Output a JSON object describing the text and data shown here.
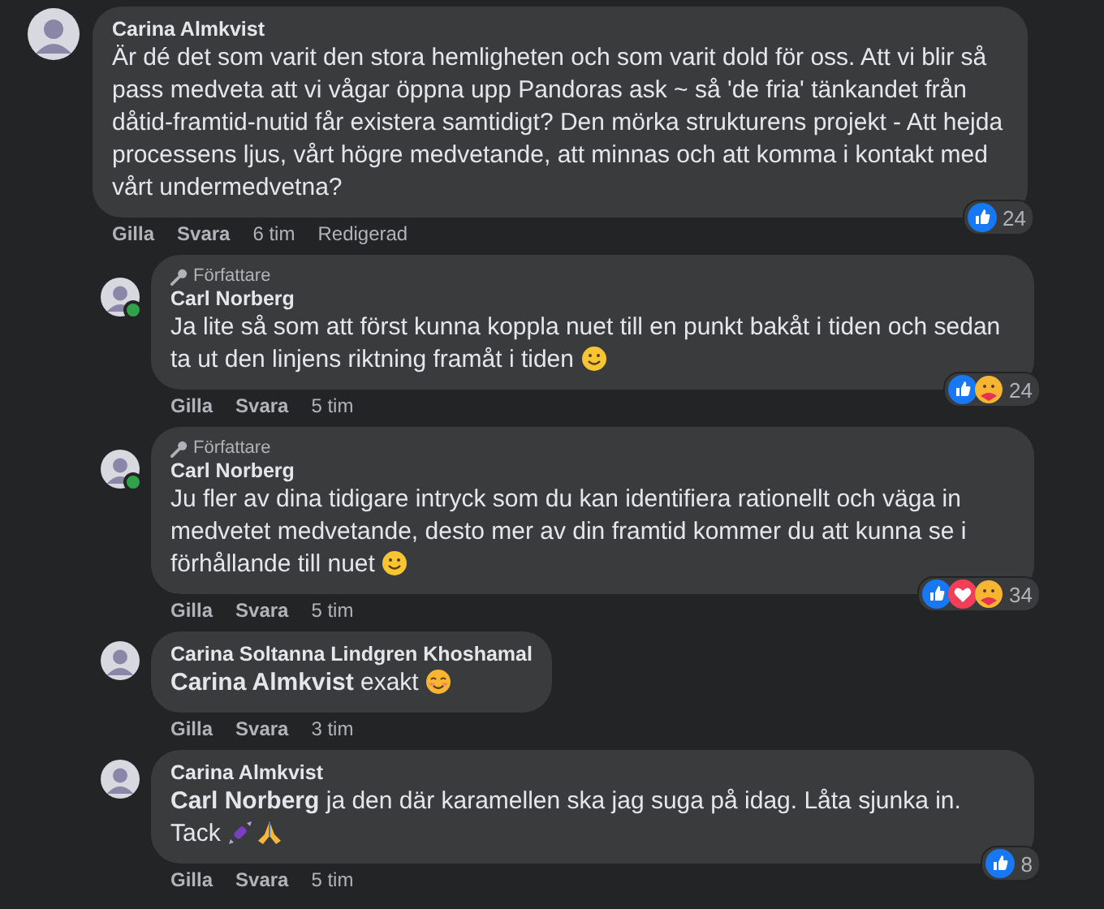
{
  "comment": {
    "author": "Carina Almkvist",
    "online": false,
    "parts": [
      {
        "kind": "text",
        "text": "Är dé det som varit den stora hemligheten och som varit dold för oss. Att vi blir så pass medveta att vi vågar öppna upp Pandoras ask ~ så 'de fria' tänkandet från dåtid-framtid-nutid får existera samtidigt? Den mörka strukturens projekt - Att hejda processens ljus, vårt högre medvetande, att minnas och att komma i kontakt med vårt undermedvetna?"
      }
    ],
    "actions": [
      "Gilla",
      "Svara"
    ],
    "time": "6 tim",
    "edited": "Redigerad",
    "reactions": [
      {
        "kind": "like"
      }
    ],
    "reaction_count": "24",
    "replies": [
      {
        "badge": "Författare",
        "author": "Carl Norberg",
        "online": true,
        "parts": [
          {
            "kind": "text",
            "text": "Ja lite så som att först kunna koppla nuet till en punkt bakåt i tiden och sedan ta ut den linjens riktning framåt i tiden "
          },
          {
            "kind": "smile"
          }
        ],
        "actions": [
          "Gilla",
          "Svara"
        ],
        "time": "5 tim",
        "reactions": [
          {
            "kind": "like"
          },
          {
            "kind": "care"
          }
        ],
        "reaction_count": "24"
      },
      {
        "badge": "Författare",
        "author": "Carl Norberg",
        "online": true,
        "parts": [
          {
            "kind": "text",
            "text": "Ju fler av dina tidigare intryck som du kan identifiera rationellt och väga in medvetet medvetande, desto mer av din framtid kommer du att kunna se i förhållande till nuet "
          },
          {
            "kind": "smile"
          }
        ],
        "actions": [
          "Gilla",
          "Svara"
        ],
        "time": "5 tim",
        "reactions": [
          {
            "kind": "like"
          },
          {
            "kind": "love"
          },
          {
            "kind": "care"
          }
        ],
        "reaction_count": "34"
      },
      {
        "author": "Carina Soltanna Lindgren Khoshamal",
        "online": false,
        "parts": [
          {
            "kind": "mention",
            "text": "Carina Almkvist"
          },
          {
            "kind": "text",
            "text": " exakt "
          },
          {
            "kind": "blush"
          }
        ],
        "actions": [
          "Gilla",
          "Svara"
        ],
        "time": "3 tim"
      },
      {
        "author": "Carina Almkvist",
        "online": false,
        "parts": [
          {
            "kind": "mention",
            "text": "Carl Norberg"
          },
          {
            "kind": "text",
            "text": " ja den där karamellen ska jag suga på idag. Låta sjunka in. Tack "
          },
          {
            "kind": "candy"
          },
          {
            "kind": "pray"
          }
        ],
        "actions": [
          "Gilla",
          "Svara"
        ],
        "time": "5 tim",
        "reactions": [
          {
            "kind": "like"
          }
        ],
        "reaction_count": "8"
      }
    ]
  }
}
